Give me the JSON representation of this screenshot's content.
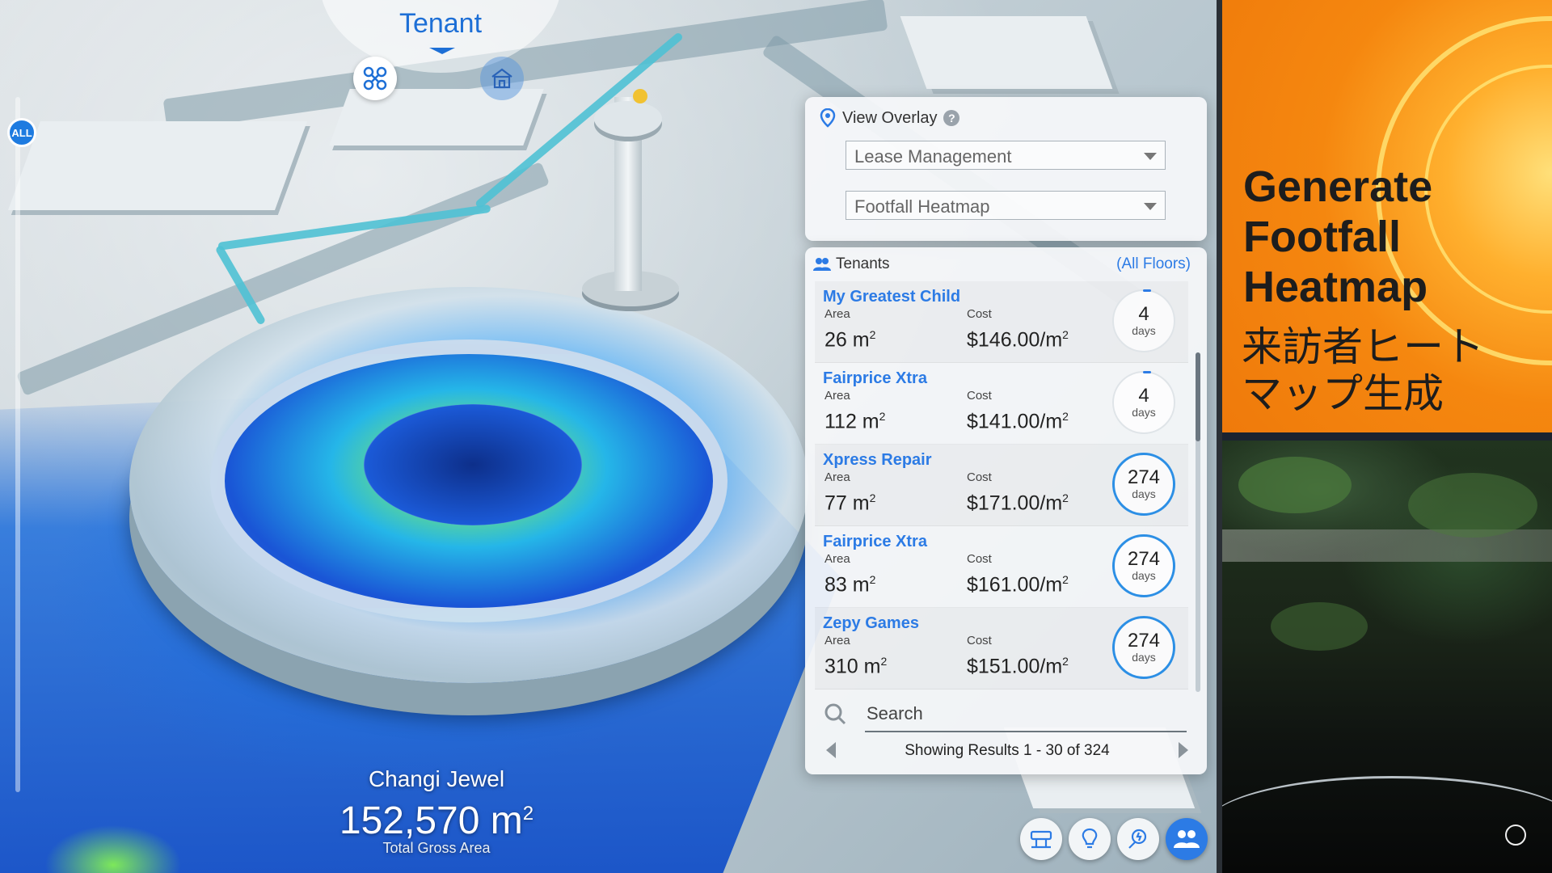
{
  "dial": {
    "title": "Tenant",
    "icons": [
      "drone-icon",
      "building-icon"
    ]
  },
  "left_control": {
    "all_label": "ALL"
  },
  "overlay": {
    "title": "View Overlay",
    "help": "?",
    "select_1": "Lease Management",
    "select_2": "Footfall Heatmap"
  },
  "tenants": {
    "title": "Tenants",
    "filter": "(All Floors)",
    "area_label": "Area",
    "cost_label": "Cost",
    "unit_label": "days",
    "items": [
      {
        "name": "My Greatest Child",
        "area": "26 m",
        "cost": "$146.00/m",
        "days": "4"
      },
      {
        "name": "Fairprice Xtra",
        "area": "112 m",
        "cost": "$141.00/m",
        "days": "4"
      },
      {
        "name": "Xpress Repair",
        "area": "77 m",
        "cost": "$171.00/m",
        "days": "274"
      },
      {
        "name": "Fairprice Xtra",
        "area": "83 m",
        "cost": "$161.00/m",
        "days": "274"
      },
      {
        "name": "Zepy Games",
        "area": "310 m",
        "cost": "$151.00/m",
        "days": "274"
      }
    ],
    "superscript": "2",
    "search_placeholder": "Search",
    "results": "Showing Results 1 - 30 of 324"
  },
  "caption": {
    "name": "Changi Jewel",
    "area": "152,570 m",
    "area_sup": "2",
    "label": "Total Gross Area"
  },
  "toolbar": {
    "icons": [
      "signage-icon",
      "lightbulb-icon",
      "energy-icon",
      "people-icon"
    ],
    "active": "people-icon"
  },
  "promo": {
    "title_lines": [
      "Generate",
      "Footfall",
      "Heatmap"
    ],
    "jp_lines": [
      "来訪者ヒート",
      "マップ生成"
    ],
    "bg_color": "#f5870f"
  },
  "colors": {
    "accent": "#2c7be5"
  }
}
